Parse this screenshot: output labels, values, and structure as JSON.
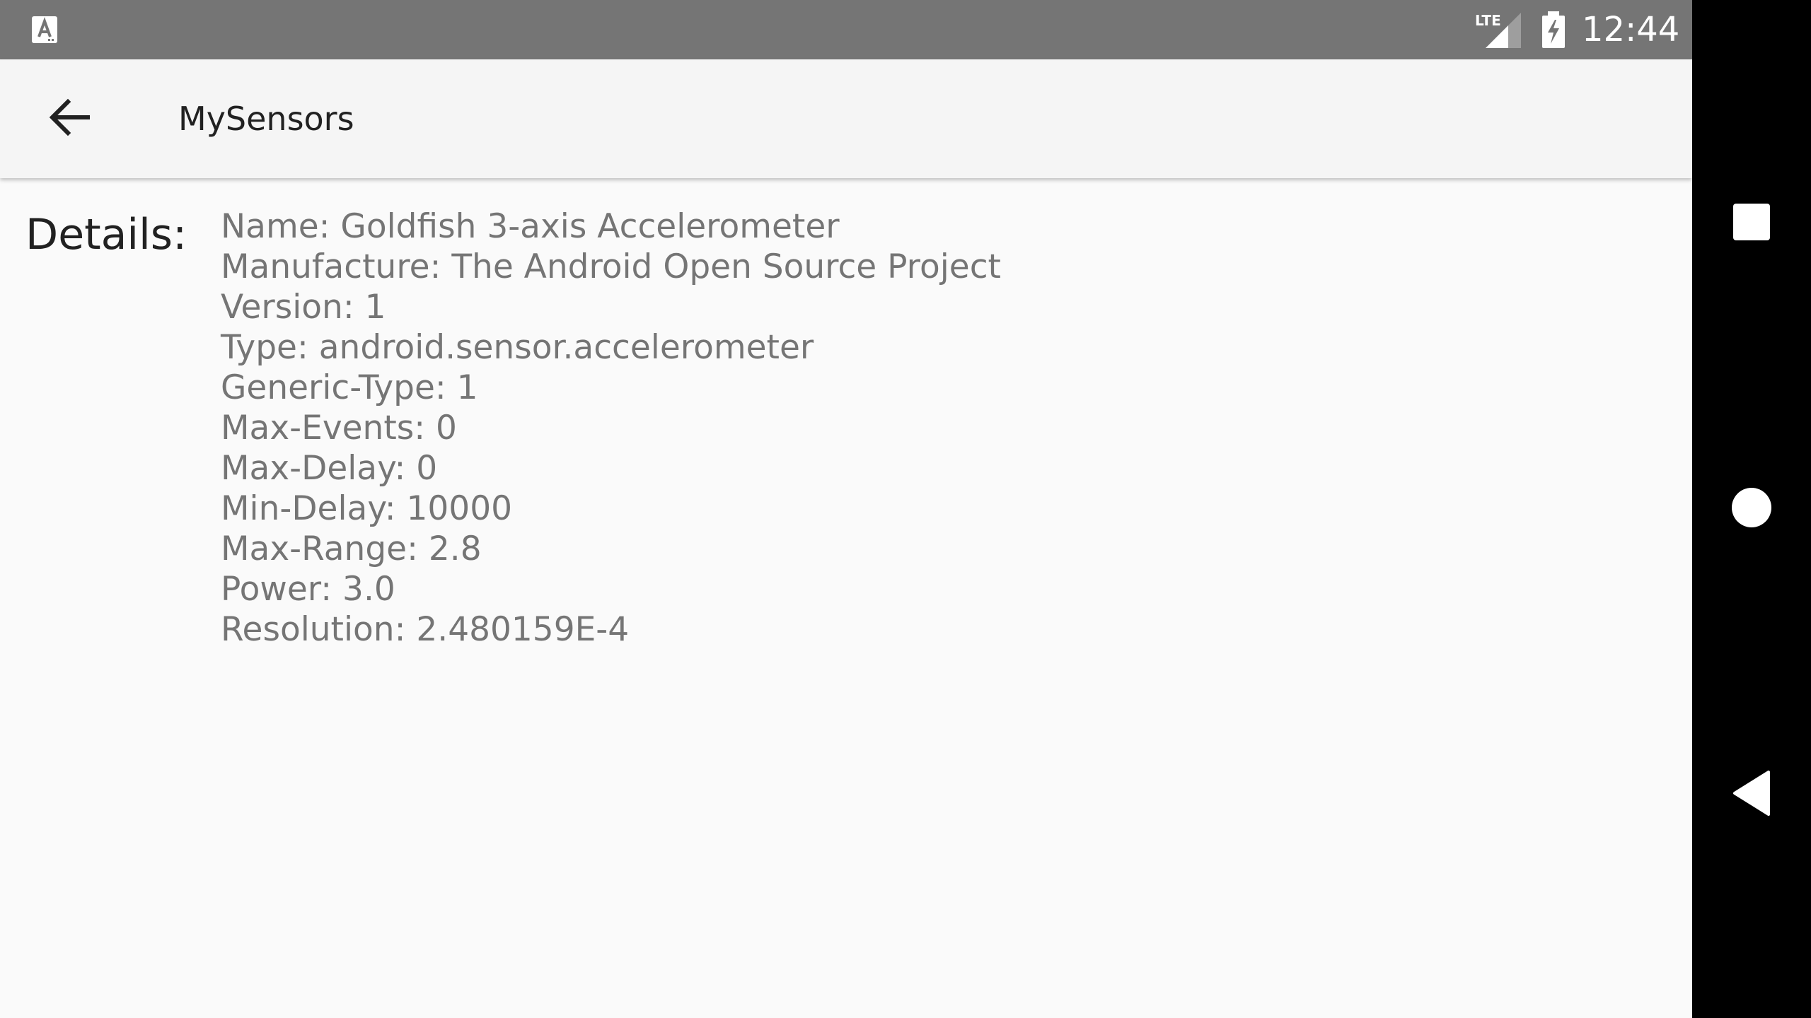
{
  "status_bar": {
    "time": "12:44",
    "network_label": "LTE",
    "icons": [
      "text-input-notification-icon",
      "lte-signal-icon",
      "battery-charging-icon"
    ]
  },
  "app_bar": {
    "title": "MySensors",
    "back_icon": "arrow-back-icon"
  },
  "details": {
    "label": "Details:",
    "lines": [
      "Name: Goldfish 3-axis Accelerometer",
      "Manufacture: The Android Open Source Project",
      "Version: 1",
      "Type: android.sensor.accelerometer",
      "Generic-Type: 1",
      "Max-Events: 0",
      "Max-Delay: 0",
      "Min-Delay: 10000",
      "Max-Range: 2.8",
      "Power: 3.0",
      "Resolution: 2.480159E-4"
    ]
  },
  "navigation_bar": {
    "buttons": [
      "recents-icon",
      "home-icon",
      "back-triangle-icon"
    ]
  },
  "colors": {
    "status_bar": "#757575",
    "app_bar": "#f5f5f5",
    "background": "#fafafa",
    "nav_bar": "#000000",
    "primary_text": "#212121",
    "secondary_text": "#757575"
  }
}
